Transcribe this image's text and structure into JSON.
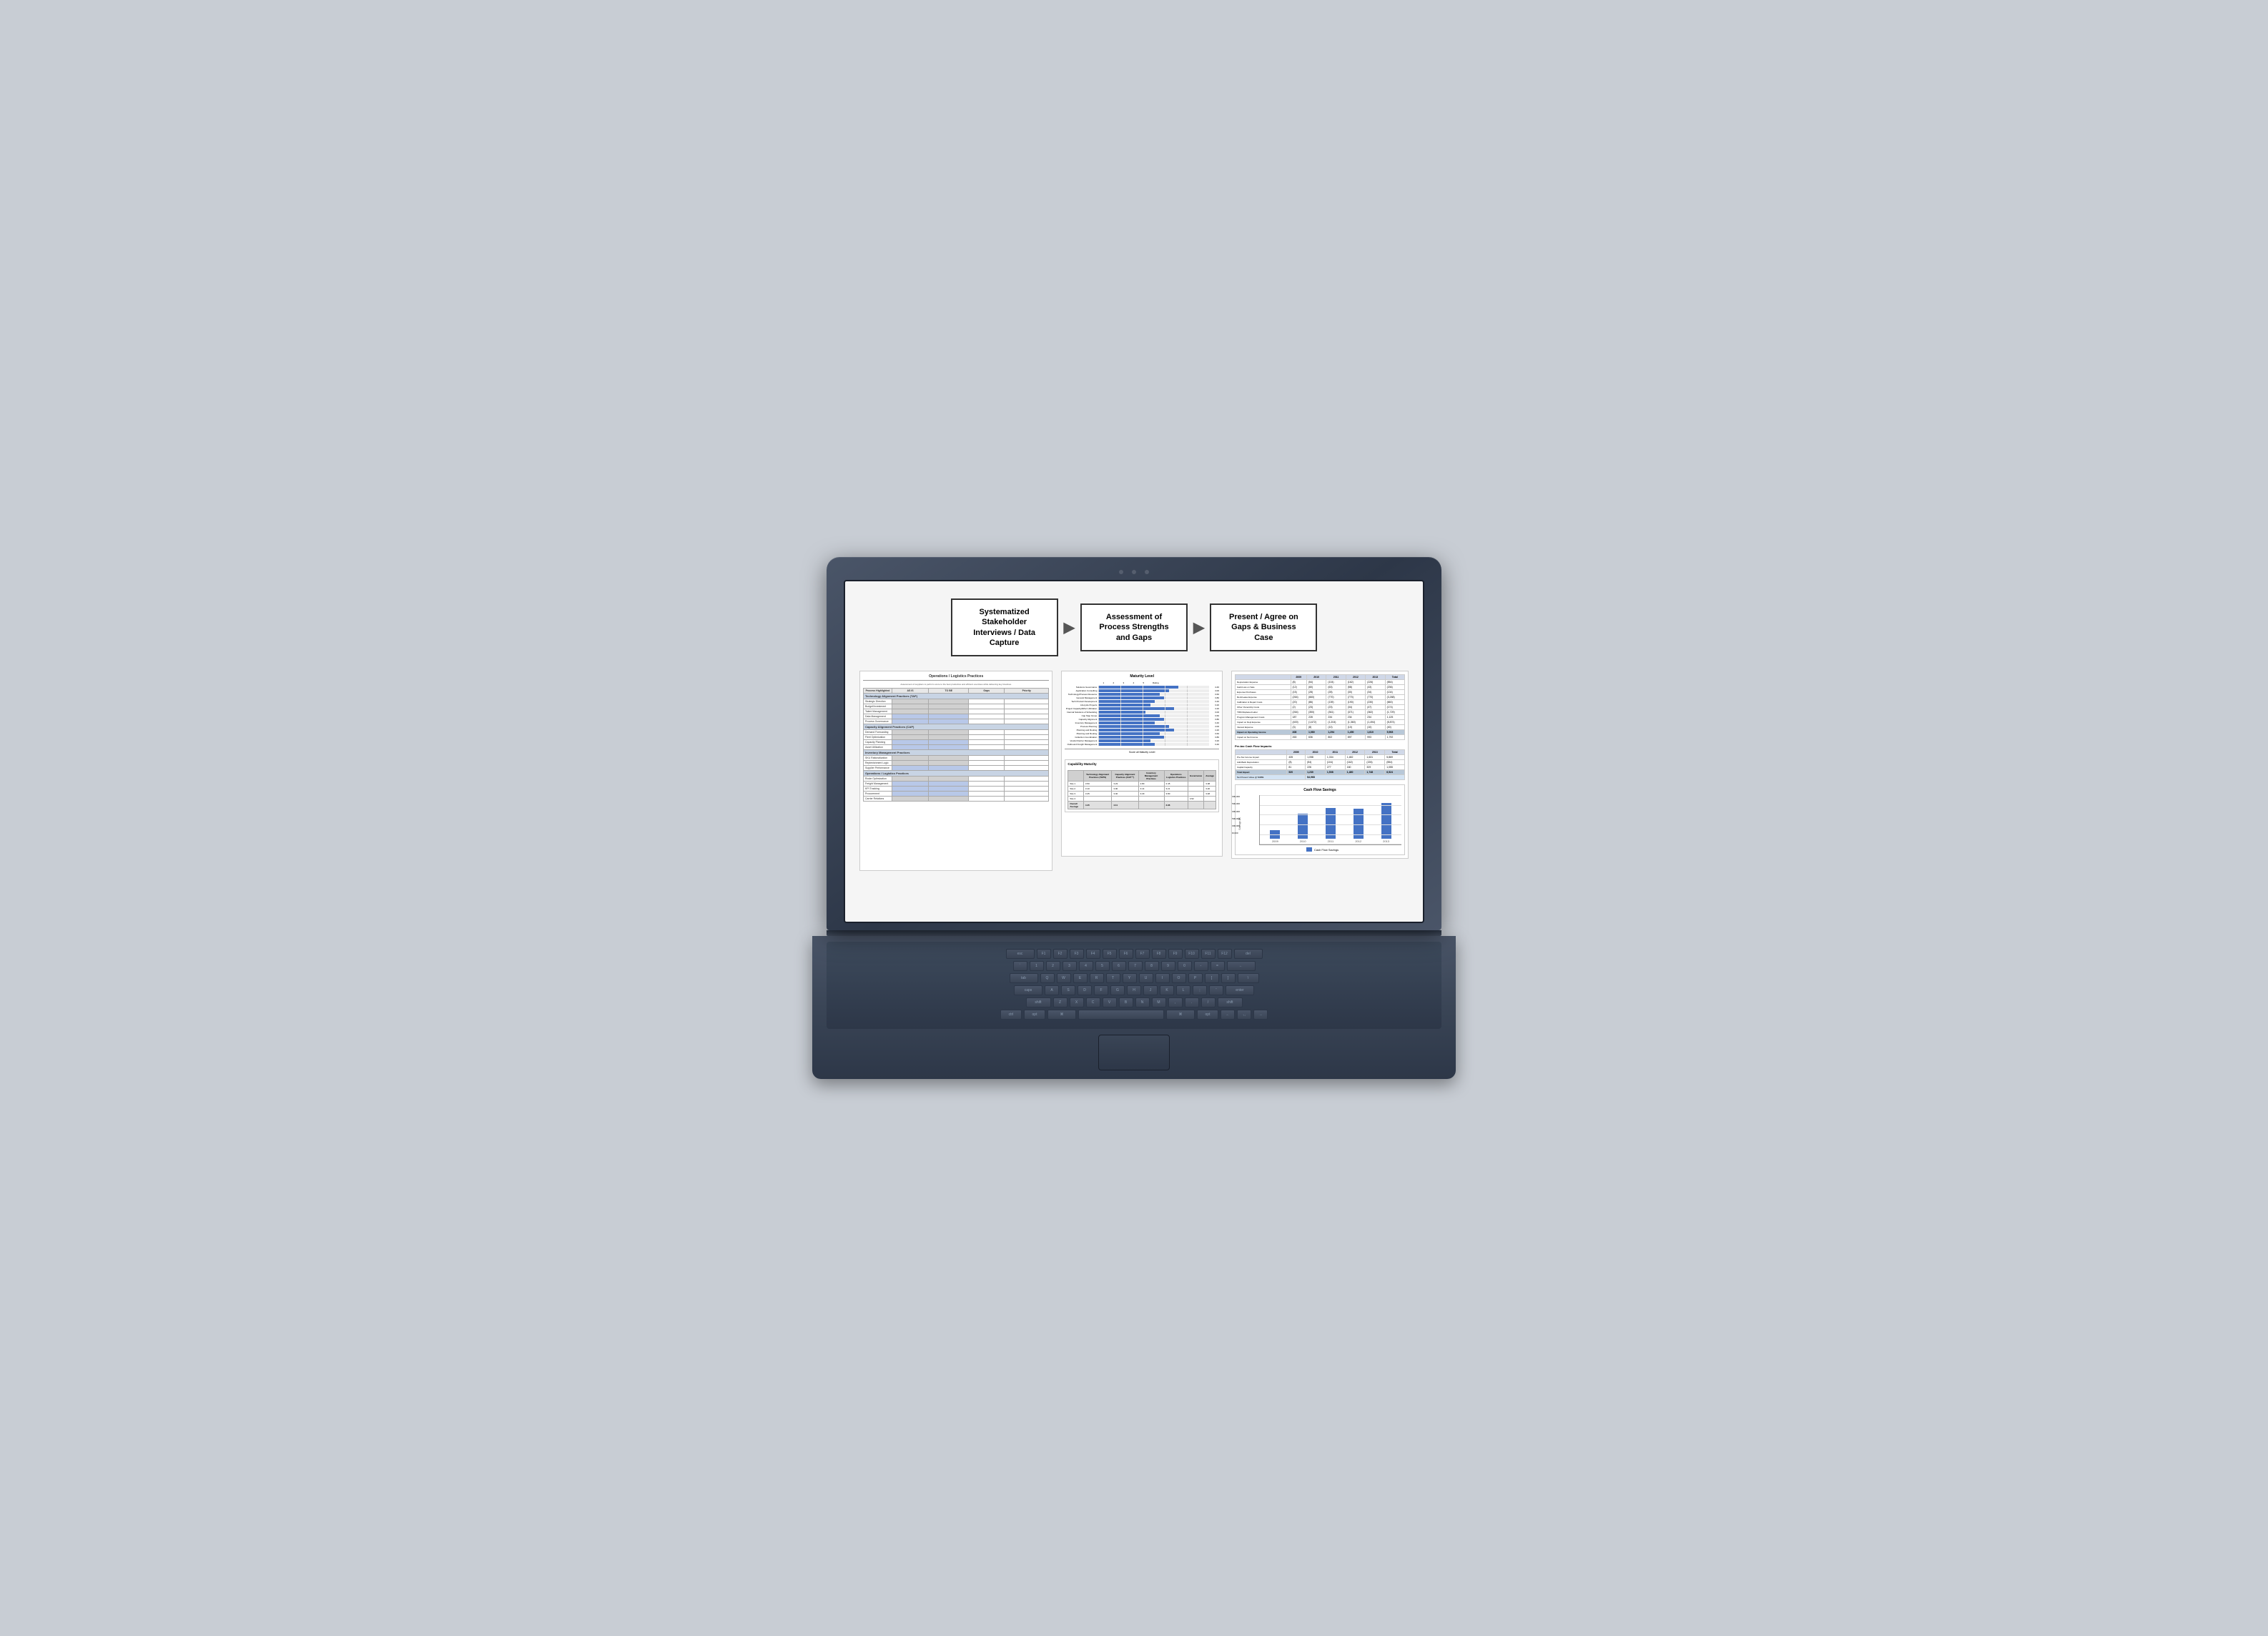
{
  "laptop": {
    "screen_bg": "#f5f5f5"
  },
  "workflow": {
    "step1": {
      "label": "Systematized Stakeholder Interviews / Data Capture"
    },
    "step2": {
      "label": "Assessment of Process Strengths and Gaps"
    },
    "step3": {
      "label": "Present  / Agree on Gaps & Business Case"
    },
    "arrow": "▶"
  },
  "doc1": {
    "title": "Operations / Logistics Practices",
    "subtitle": "Assessment of suppliers to perform score to the level of practices and efficient exercises while delivering key timelines. Capturing of the work level priorities such as deficiencies and functions",
    "cols": [
      "Process Highlighted",
      "AS IS",
      "TO BE",
      "Gaps",
      "Priority"
    ],
    "section1": "Technology Alignment Practices (TAP)",
    "section2": "Capacity Alignment Practices (CAP)",
    "section3": "Inventory Management Practices",
    "section4": "Operations / Logistics Practices"
  },
  "doc2": {
    "title": "Maturity Level",
    "subtitle": "Score all Maturity Level",
    "rows": [
      {
        "label": "Solutions Governance",
        "pct": 85
      },
      {
        "label": "Application Consulting",
        "pct": 75
      },
      {
        "label": "Technology/Process Resource",
        "pct": 65
      },
      {
        "label": "General Management",
        "pct": 70
      },
      {
        "label": "Tech Product Development",
        "pct": 60
      },
      {
        "label": "Lifecycle Projects",
        "pct": 55
      },
      {
        "label": "Project Capacity/Effort Utilization",
        "pct": 80
      },
      {
        "label": "Internal Solutions of Scheduling",
        "pct": 50
      },
      {
        "label": "Cap Step Group",
        "pct": 65
      },
      {
        "label": "Capacity Alignment",
        "pct": 70
      },
      {
        "label": "Inventory Management",
        "pct": 60
      },
      {
        "label": "Process Planning",
        "pct": 75
      },
      {
        "label": "Planning and Routing",
        "pct": 80
      },
      {
        "label": "Planning and Routing",
        "pct": 65
      },
      {
        "label": "Collection Coordination",
        "pct": 70
      },
      {
        "label": "Vendor/Carrier Management",
        "pct": 55
      },
      {
        "label": "Outbound Freight Management",
        "pct": 60
      }
    ]
  },
  "doc3": {
    "fin_table": {
      "headers": [
        "",
        "2009",
        "2010",
        "2011",
        "2012",
        "2013",
        "Total"
      ],
      "rows": [
        {
          "label": "Depreciation Expense",
          "vals": [
            "(8)",
            "(54)",
            "(104)",
            "(162)",
            "(226)",
            "(554)"
          ]
        },
        {
          "label": "Gain/Loss on Sale",
          "vals": [
            "(12)",
            "(60)",
            "(63)",
            "(58)",
            "(43)",
            "(236)"
          ]
        },
        {
          "label": "Expense Purchases",
          "vals": [
            "(15)",
            "(28)",
            "(28)",
            "(30)",
            "(34)",
            "(134)"
          ]
        },
        {
          "label": "Rent/Lease Expense",
          "vals": [
            "(264)",
            "(660)",
            "(770)",
            "(770)",
            "(770)",
            "(3,266)"
          ]
        },
        {
          "label": "Calibration & Repair Costs",
          "vals": [
            "(20)",
            "(86)",
            "(139)",
            "(190)",
            "(236)",
            "(660)"
          ]
        },
        {
          "label": "Other Ownership Costs",
          "vals": [
            "(2)",
            "(23)",
            "(23)",
            "(34)",
            "(34)",
            "(174)"
          ]
        },
        {
          "label": "TRM Displaced Labor",
          "vals": [
            "(264)",
            "(350)",
            "(361)",
            "(371)",
            "(362)",
            "(1,729)"
          ]
        },
        {
          "label": "Program Management Costs",
          "vals": [
            "187",
            "228",
            "234",
            "234",
            "234",
            "1,125"
          ]
        },
        {
          "label": "Impact on Dept Expense",
          "vals": [
            "(400)",
            "(1,672)",
            "(1,204)",
            "(1,360)",
            "(1,494)",
            "(5,874)"
          ]
        },
        {
          "label": "Interest Expense",
          "vals": [
            "(3)",
            "(8)",
            "(10)",
            "(10)",
            "(10)",
            "(40)"
          ]
        },
        {
          "label": "Impact on Operating Income",
          "vals": [
            "408",
            "1,080",
            "1,294",
            "1,450",
            "1,610",
            "5,908"
          ],
          "highlight": true
        },
        {
          "label": "Impact on Net Income",
          "vals": [
            "263",
            "636",
            "802",
            "897",
            "993",
            "1,792"
          ]
        }
      ]
    },
    "cashflow_table": {
      "title": "Pre-tax Cash Flow Impacts:",
      "headers": [
        "",
        "2009",
        "2010",
        "2011",
        "2012",
        "2013",
        "Total"
      ],
      "rows": [
        {
          "label": "Pre-Tax Income Impact",
          "vals": [
            "435",
            "1,058",
            "1,334",
            "1,482",
            "1,631",
            "5,869"
          ]
        },
        {
          "label": "Add-Back Depreciation",
          "vals": [
            "(8)",
            "(54)",
            "(104)",
            "(162)",
            "(226)",
            "(554)"
          ]
        },
        {
          "label": "Capital Capacity",
          "vals": [
            "81",
            "226",
            "277",
            "160",
            "329",
            "1,055"
          ]
        },
        {
          "label": "Total Impact",
          "vals": [
            "520",
            "1,230",
            "1,508",
            "1,480",
            "1,748",
            "6,524"
          ],
          "highlight": true
        },
        {
          "label": "Net Present Value @",
          "rate": "5.00%",
          "npv": "$4,968"
        }
      ]
    },
    "chart": {
      "title": "Cash Flow Savings",
      "bars": [
        {
          "year": "2009",
          "value": 520,
          "height": 15
        },
        {
          "year": "2010",
          "value": 1230,
          "height": 35
        },
        {
          "year": "2011",
          "value": 1508,
          "height": 43
        },
        {
          "year": "2012",
          "value": 1480,
          "height": 42
        },
        {
          "year": "2013",
          "value": 1748,
          "height": 50
        }
      ],
      "y_labels": [
        "$3,000,000",
        "$2,500,000",
        "$2,000,000",
        "$1,500,000",
        "$1,000,000",
        "$500,000",
        "$0"
      ],
      "legend": "Cash Flow Savings",
      "y_axis_label": "Savings $K"
    },
    "cap_table": {
      "title": "Capability Maturity",
      "headers": [
        "",
        "Technology Alignment Practices (TAPS)",
        "Capacity Alignment Practices (CAP™)",
        "Inventory Management Practices",
        "Operations Logistics Practices",
        "Governance",
        "Average"
      ],
      "rows": [
        {
          "site": "Site 1",
          "vals": [
            "3.50",
            "3.23",
            "2.80",
            "2.45",
            "",
            "3.08"
          ]
        },
        {
          "site": "Site 2",
          "vals": [
            "3.10",
            "3.00",
            "3.14",
            "3.21",
            "",
            "3.20"
          ]
        },
        {
          "site": "Site 3",
          "vals": [
            "3.45",
            "3.40",
            "3.29",
            "3.80",
            "",
            "3.48"
          ]
        },
        {
          "site": "Site 4",
          "vals": [
            "",
            "",
            "",
            "",
            "4.52",
            ""
          ]
        },
        {
          "site": "Overall Average",
          "vals": [
            "4.45",
            "4.11",
            "",
            "3.96",
            "",
            ""
          ]
        }
      ]
    }
  },
  "keyboard": {
    "rows": [
      [
        "esc",
        "F1",
        "F2",
        "F3",
        "F4",
        "F5",
        "F6",
        "F7",
        "F8",
        "F9",
        "F10",
        "F11",
        "F12",
        "del"
      ],
      [
        "`",
        "1",
        "2",
        "3",
        "4",
        "5",
        "6",
        "7",
        "8",
        "9",
        "0",
        "-",
        "=",
        "←"
      ],
      [
        "tab",
        "Q",
        "W",
        "E",
        "R",
        "T",
        "Y",
        "U",
        "I",
        "O",
        "P",
        "[",
        "]",
        "\\"
      ],
      [
        "caps",
        "A",
        "S",
        "D",
        "F",
        "G",
        "H",
        "J",
        "K",
        "L",
        ";",
        "'",
        "enter"
      ],
      [
        "shift",
        "Z",
        "X",
        "C",
        "V",
        "B",
        "N",
        "M",
        ",",
        ".",
        "/",
        "shift"
      ],
      [
        "ctrl",
        "opt",
        "cmd",
        "",
        "",
        "",
        "",
        "",
        "cmd",
        "opt",
        "←",
        "↑↓",
        "→"
      ]
    ]
  }
}
